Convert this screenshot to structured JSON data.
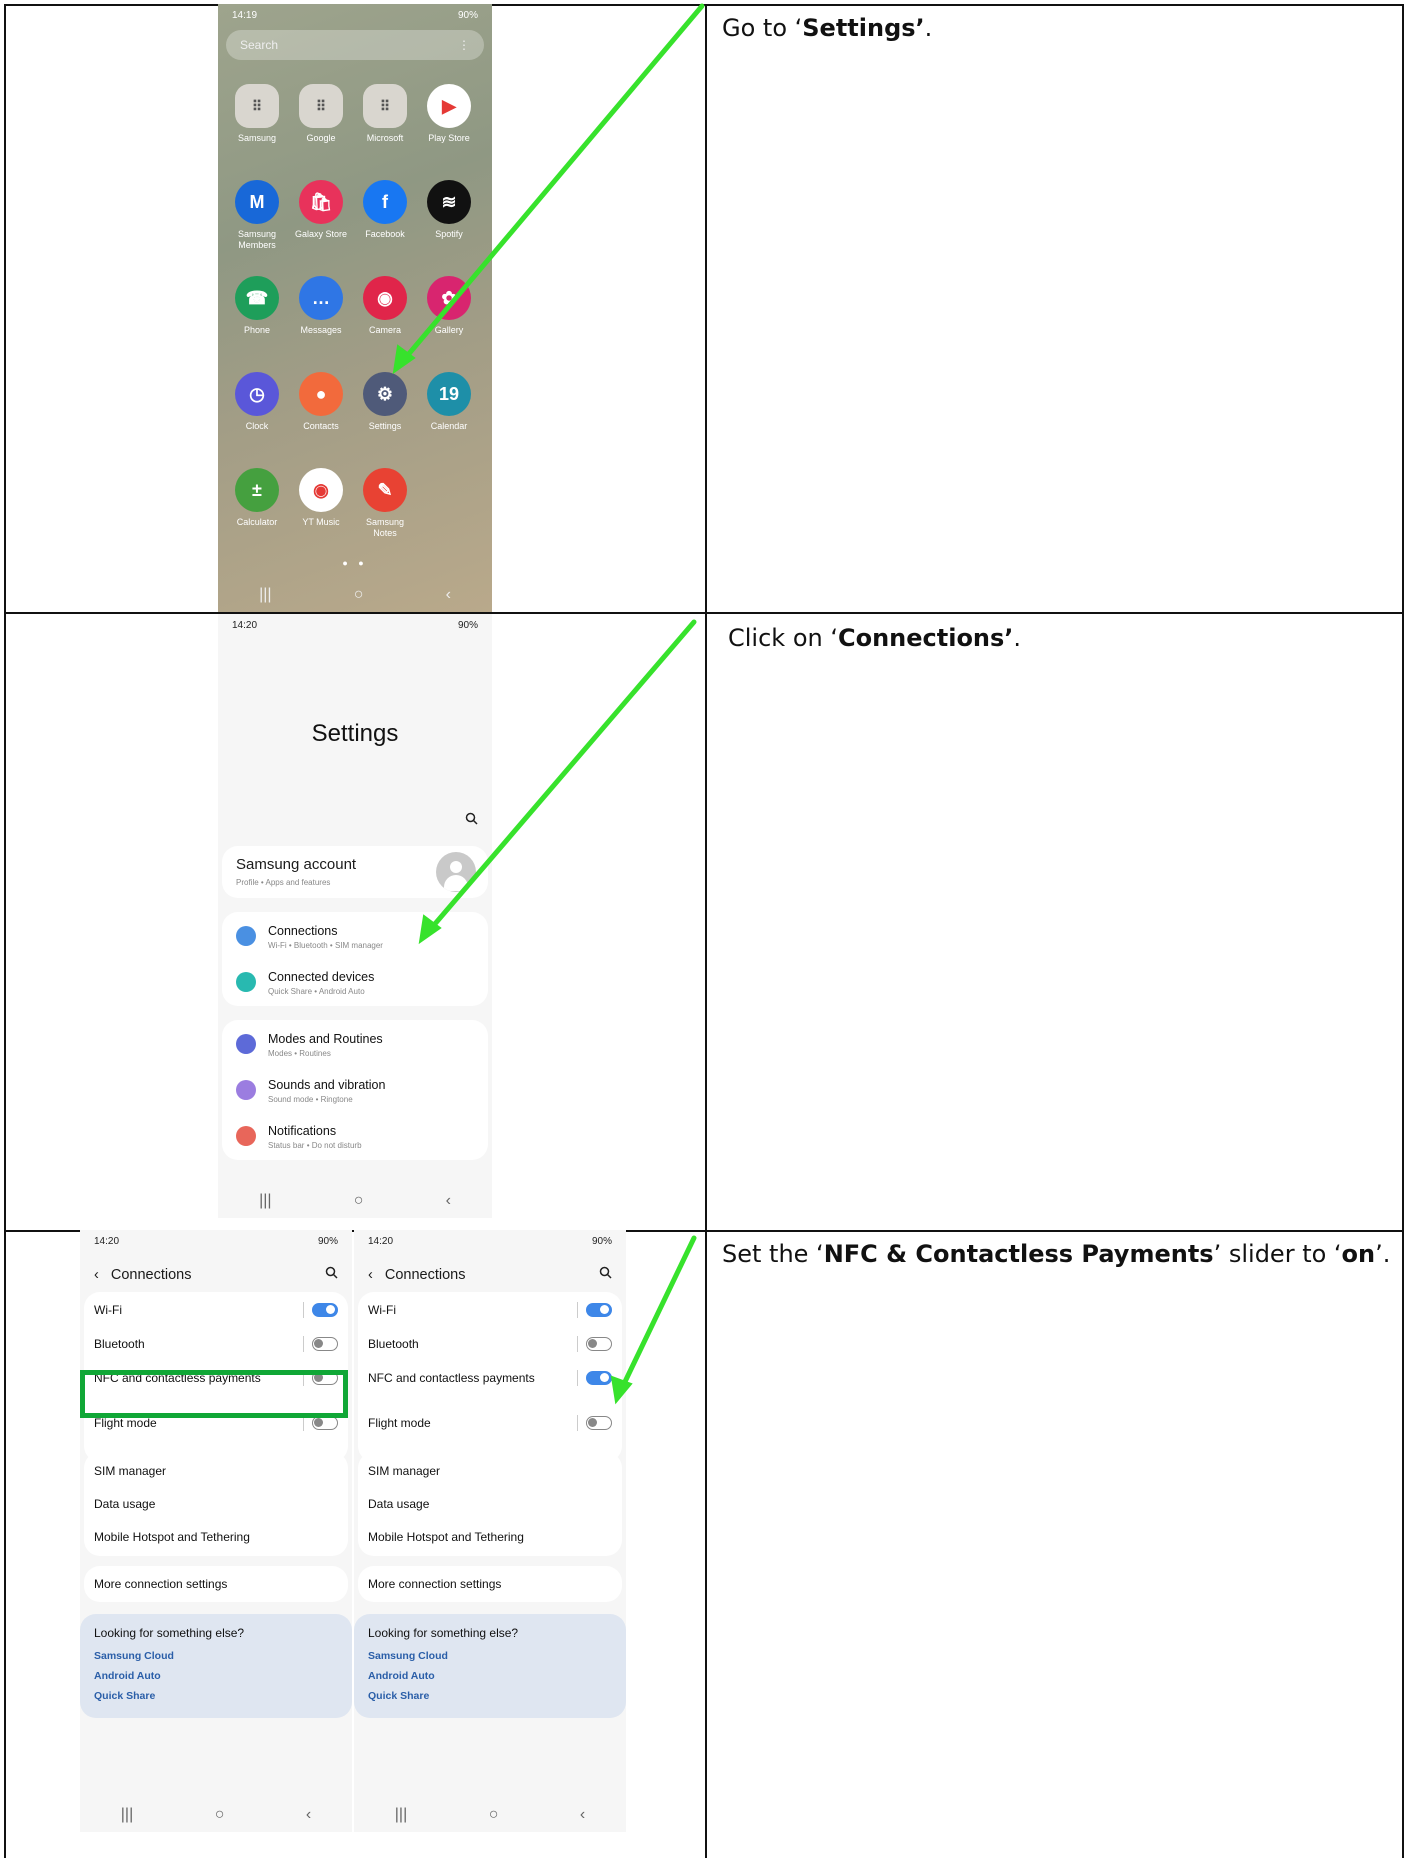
{
  "rows": [
    {
      "prefix": "Go to ‘",
      "bold": "Settings’",
      "suffix": "."
    },
    {
      "prefix": "Click on ‘",
      "bold": "Connections’",
      "suffix": "."
    },
    {
      "prefix": "Set the ‘",
      "bold": "NFC & Contactless Payments",
      "mid": "’ slider to ‘",
      "bold2": "on",
      "suffix": "’."
    }
  ],
  "home": {
    "status_time": "14:19",
    "status_right": "90%",
    "search_placeholder": "Search",
    "apps": [
      {
        "label": "Samsung",
        "color": "#d9d6cf"
      },
      {
        "label": "Google",
        "color": "#d9d6cf"
      },
      {
        "label": "Microsoft",
        "color": "#d9d6cf"
      },
      {
        "label": "Play Store",
        "color": "#ffffff"
      },
      {
        "label": "Samsung Members",
        "color": "#1868d8"
      },
      {
        "label": "Galaxy Store",
        "color": "#e8325b"
      },
      {
        "label": "Facebook",
        "color": "#1877f2"
      },
      {
        "label": "Spotify",
        "color": "#111111"
      },
      {
        "label": "Phone",
        "color": "#1e9e5a"
      },
      {
        "label": "Messages",
        "color": "#2f76e5"
      },
      {
        "label": "Camera",
        "color": "#e0254a"
      },
      {
        "label": "Gallery",
        "color": "#d8256f"
      },
      {
        "label": "Clock",
        "color": "#5a57d9"
      },
      {
        "label": "Contacts",
        "color": "#f26a3c"
      },
      {
        "label": "Settings",
        "color": "#4f5a79"
      },
      {
        "label": "Calendar",
        "color": "#1e8fa8"
      },
      {
        "label": "Calculator",
        "color": "#45a03f"
      },
      {
        "label": "YT Music",
        "color": "#ffffff"
      },
      {
        "label": "Samsung Notes",
        "color": "#e84233"
      }
    ]
  },
  "settings": {
    "status_time": "14:20",
    "status_right": "90%",
    "title": "Settings",
    "account_title": "Samsung account",
    "account_sub": "Profile  •  Apps and features",
    "items": [
      {
        "title": "Connections",
        "sub": "Wi-Fi  •  Bluetooth  •  SIM manager",
        "color": "#4a90e2"
      },
      {
        "title": "Connected devices",
        "sub": "Quick Share  •  Android Auto",
        "color": "#28b9b0"
      },
      {
        "title": "Modes and Routines",
        "sub": "Modes  •  Routines",
        "color": "#5d6ad8"
      },
      {
        "title": "Sounds and vibration",
        "sub": "Sound mode  •  Ringtone",
        "color": "#9b7de0"
      },
      {
        "title": "Notifications",
        "sub": "Status bar  •  Do not disturb",
        "color": "#e8665a"
      }
    ]
  },
  "connections": {
    "status_time": "14:20",
    "status_right": "90%",
    "title": "Connections",
    "rows": [
      "Wi-Fi",
      "Bluetooth",
      "NFC and contactless payments",
      "Flight mode"
    ],
    "left_states": [
      true,
      false,
      false,
      false
    ],
    "right_states": [
      true,
      false,
      true,
      false
    ],
    "group2": [
      "SIM manager",
      "Data usage",
      "Mobile Hotspot and Tethering"
    ],
    "more": "More connection settings",
    "looking": "Looking for something else?",
    "links": [
      "Samsung Cloud",
      "Android Auto",
      "Quick Share"
    ]
  },
  "nav": {
    "recent": "|||",
    "home": "○",
    "back": "‹"
  },
  "colors": {
    "arrow": "#37e22c",
    "highlight": "#10a736",
    "toggle_on": "#3e87e8"
  }
}
